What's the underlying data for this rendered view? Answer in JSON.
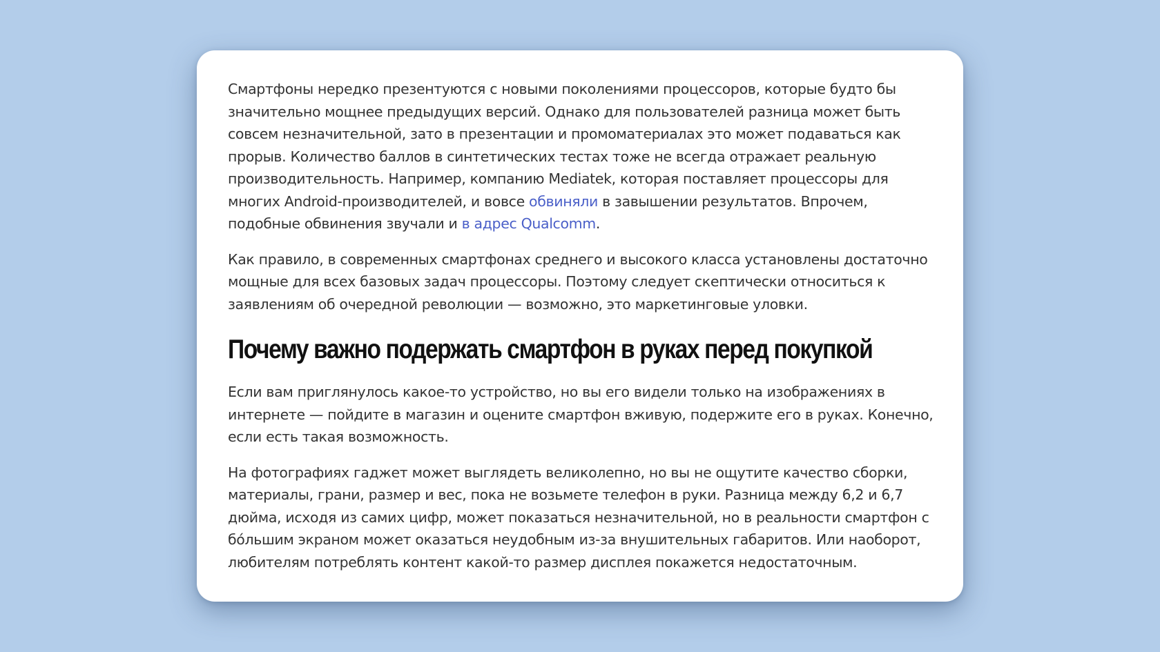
{
  "article": {
    "p1": {
      "text_a": "Смартфоны нередко презентуются с новыми поколениями процессоров, которые будто бы значительно мощнее предыдущих версий. Однако для пользователей разница может быть совсем незначительной, зато в презентации и промоматериалах это может подаваться как прорыв. Количество баллов в синтетических тестах тоже не всегда отражает реальную производительность. Например, компанию Mediatek, которая поставляет процессоры для многих Android-производителей, и вовсе ",
      "link_1": "обвиняли",
      "text_b": " в завышении результатов. Впрочем, подобные обвинения звучали и ",
      "link_2": "в адрес Qualcomm",
      "text_c": "."
    },
    "p2": "Как правило, в современных смартфонах среднего и высокого класса установлены достаточно мощные для всех базовых задач процессоры. Поэтому следует скептически относиться к заявлениям об очередной революции — возможно, это маркетинговые уловки.",
    "heading": "Почему важно подержать смартфон в руках перед покупкой",
    "p3": "Если вам приглянулось какое-то устройство, но вы его видели только на изображениях в интернете — пойдите в магазин и оцените смартфон вживую, подержите его в руках. Конечно, если есть такая возможность.",
    "p4": "На фотографиях гаджет может выглядеть великолепно, но вы не ощутите качество сборки, материалы, грани, размер и вес, пока не возьмете телефон в руки. Разница между 6,2 и 6,7 дюйма, исходя из самих цифр, может показаться незначительной, но в реальности смартфон с бо́льшим экраном может оказаться неудобным из-за внушительных габаритов. Или наоборот, любителям потреблять контент какой-то размер дисплея покажется недостаточным."
  },
  "colors": {
    "background": "#b3cdea",
    "card": "#ffffff",
    "text": "#333333",
    "link": "#4a5fc8",
    "heading": "#111111"
  }
}
